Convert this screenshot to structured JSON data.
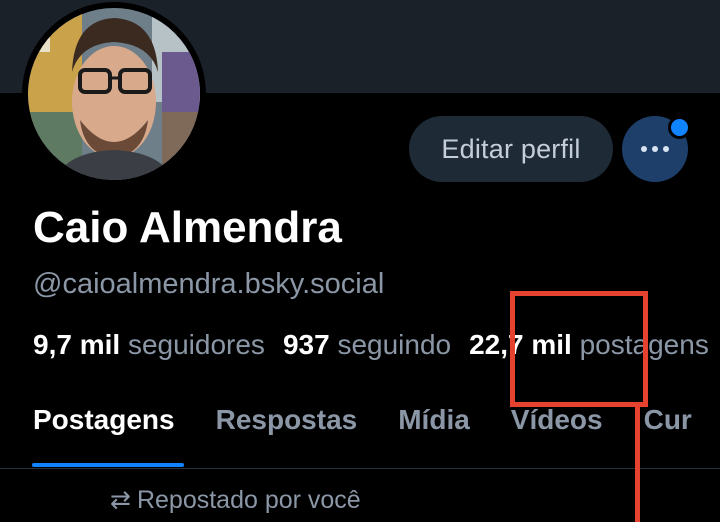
{
  "profile": {
    "display_name": "Caio Almendra",
    "handle": "@caioalmendra.bsky.social"
  },
  "actions": {
    "edit_label": "Editar perfil",
    "more_icon": "ellipsis-icon",
    "notification_color": "#1083fe"
  },
  "stats": {
    "followers_value": "9,7 mil",
    "followers_label": "seguidores",
    "following_value": "937",
    "following_label": "seguindo",
    "posts_value": "22,7 mil",
    "posts_label": "postagens"
  },
  "tabs": [
    {
      "label": "Postagens",
      "active": true
    },
    {
      "label": "Respostas",
      "active": false
    },
    {
      "label": "Mídia",
      "active": false
    },
    {
      "label": "Vídeos",
      "active": false
    },
    {
      "label": "Cur",
      "active": false
    }
  ],
  "feed": {
    "repost_label": "Repostado por você"
  },
  "colors": {
    "accent": "#1083fe",
    "annotation": "#e5432f",
    "background": "#000000",
    "muted_text": "#8b97a6"
  }
}
